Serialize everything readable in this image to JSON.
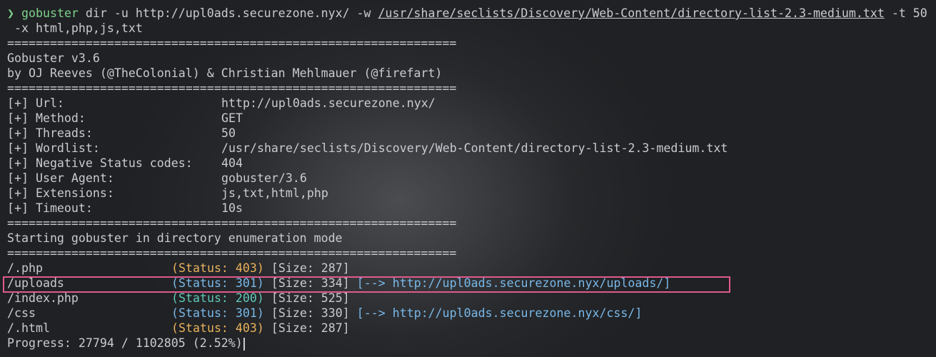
{
  "command": {
    "prompt": "❯",
    "program": "gobuster",
    "args_a": " dir -u http://upl0ads.securezone.nyx/ -w ",
    "wordlist": "/usr/share/seclists/Discovery/Web-Content/directory-list-2.3-medium.txt",
    "args_b": " -t 50",
    "args_c": " -x html,php,js,txt"
  },
  "separator": "===============================================================",
  "banner": {
    "version": "Gobuster v3.6",
    "authors": "by OJ Reeves (@TheColonial) & Christian Mehlmauer (@firefart)"
  },
  "config": [
    {
      "key": "[+] Url:",
      "value": "http://upl0ads.securezone.nyx/"
    },
    {
      "key": "[+] Method:",
      "value": "GET"
    },
    {
      "key": "[+] Threads:",
      "value": "50"
    },
    {
      "key": "[+] Wordlist:",
      "value": "/usr/share/seclists/Discovery/Web-Content/directory-list-2.3-medium.txt"
    },
    {
      "key": "[+] Negative Status codes:",
      "value": "404"
    },
    {
      "key": "[+] User Agent:",
      "value": "gobuster/3.6"
    },
    {
      "key": "[+] Extensions:",
      "value": "js,txt,html,php"
    },
    {
      "key": "[+] Timeout:",
      "value": "10s"
    }
  ],
  "start_message": "Starting gobuster in directory enumeration mode",
  "results": [
    {
      "path": "/.php",
      "status": "(Status: 403)",
      "size": "[Size: 287]",
      "redirect": ""
    },
    {
      "path": "/uploads",
      "status": "(Status: 301)",
      "size": "[Size: 334]",
      "redirect": "[--> http://upl0ads.securezone.nyx/uploads/]"
    },
    {
      "path": "/index.php",
      "status": "(Status: 200)",
      "size": "[Size: 525]",
      "redirect": ""
    },
    {
      "path": "/css",
      "status": "(Status: 301)",
      "size": "[Size: 330]",
      "redirect": "[--> http://upl0ads.securezone.nyx/css/]"
    },
    {
      "path": "/.html",
      "status": "(Status: 403)",
      "size": "[Size: 287]",
      "redirect": ""
    }
  ],
  "progress": "Progress: 27794 / 1102805 (2.52%)",
  "colors": {
    "status_403": "#e8b25c",
    "status_301": "#79b8e8",
    "status_200": "#5fc8b8",
    "highlight": "#e05a8c"
  }
}
